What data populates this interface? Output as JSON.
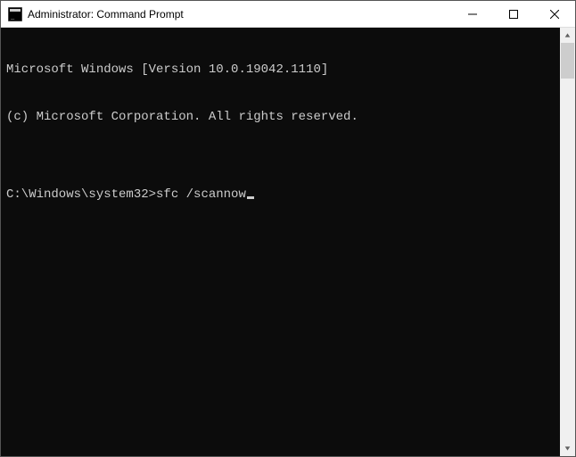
{
  "window": {
    "title": "Administrator: Command Prompt"
  },
  "terminal": {
    "lines": [
      "Microsoft Windows [Version 10.0.19042.1110]",
      "(c) Microsoft Corporation. All rights reserved.",
      ""
    ],
    "prompt": "C:\\Windows\\system32>",
    "command": "sfc /scannow"
  }
}
